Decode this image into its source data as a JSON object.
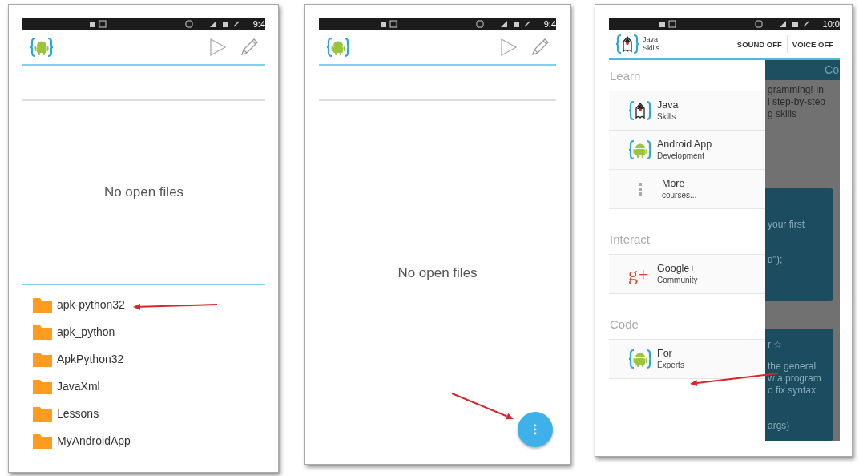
{
  "screens": [
    {
      "kind": "file-browser",
      "status_time": "9:4",
      "message": "No open files",
      "folders": [
        "apk-python32",
        "apk_python",
        "ApkPython32",
        "JavaXml",
        "Lessons",
        "MyAndroidApp"
      ]
    },
    {
      "kind": "empty-editor",
      "status_time": "9:4",
      "message": "No open files"
    },
    {
      "kind": "nav-drawer",
      "status_time": "10:0",
      "app_title": "Java",
      "app_subtitle": "Skills",
      "actions": [
        "SOUND OFF",
        "VOICE OFF"
      ],
      "sections": [
        {
          "title": "Learn",
          "items": [
            {
              "kind": "mascot",
              "title": "Java",
              "subtitle": "Skills"
            },
            {
              "kind": "android",
              "title": "Android App",
              "subtitle": "Development"
            },
            {
              "kind": "more",
              "title": "More",
              "subtitle": "courses..."
            }
          ]
        },
        {
          "title": "Interact",
          "items": [
            {
              "kind": "glyph",
              "glyph": "g+",
              "title": "Google+",
              "subtitle": "Community"
            }
          ]
        },
        {
          "title": "Code",
          "items": [
            {
              "kind": "android",
              "title": "For",
              "subtitle": "Experts"
            }
          ]
        }
      ],
      "behind": {
        "header_fragment": "Co",
        "intro_lines": [
          "gramming! In",
          "l step-by-step",
          "g skills"
        ],
        "cards": [
          {
            "lines": [
              "your first",
              "d\");"
            ]
          },
          {
            "lines": [
              "r ☆",
              "the general",
              "w a program",
              "o fix syntax",
              "args)"
            ]
          }
        ]
      }
    }
  ]
}
